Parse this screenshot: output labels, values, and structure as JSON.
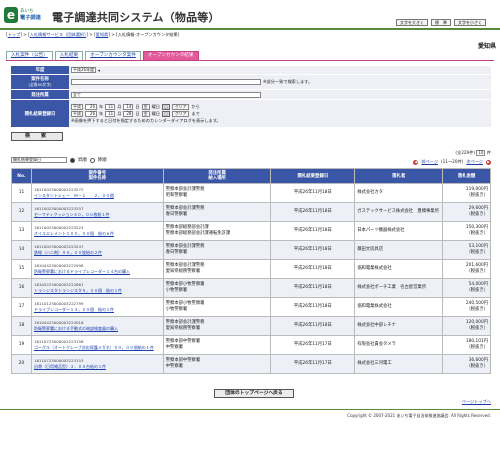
{
  "header": {
    "logo_letter": "e",
    "logo_top": "あいち",
    "logo_bottom": "電子調達",
    "title": "電子調達共同システム（物品等）",
    "buttons": [
      "文字を大きく",
      "標　準",
      "文字を小さく"
    ]
  },
  "breadcrumb": [
    "トップ",
    "入札情報サービス（団体選択）",
    "愛知県",
    "入札情報-オープンカウンタ結果"
  ],
  "region": "愛知県",
  "tabs": [
    "入札案件（公告）",
    "入札結果",
    "オープンカウンタ案件",
    "オープンカウンタ結果"
  ],
  "form": {
    "year_label": "年度",
    "year_value": "平成26年度",
    "name_label": "案件名称",
    "name_sub": "(全角50文字)",
    "name_note": "※部分一致で検索します。",
    "type_label": "発注所属",
    "type_value": "全て",
    "date_label": "開札結果登録日",
    "from_era": "平成",
    "from_y": "26",
    "from_m": "11",
    "from_d": "14",
    "from_w": "金",
    "to_era": "平成",
    "to_y": "26",
    "to_m": "11",
    "to_d": "28",
    "to_w": "金",
    "y": "年",
    "m": "月",
    "d": "日",
    "wd": "曜日",
    "cal": "□",
    "clear": "クリア",
    "from_suffix": "から",
    "to_suffix": "まで",
    "date_note": "※画像を押下すると日付を指定するためのカレンダーダイアログを表示します。",
    "search": "検　索"
  },
  "sort": {
    "value": "開札結果登録日",
    "asc": "昇順",
    "desc": "降順"
  },
  "pager": {
    "total": "(全229件)",
    "per_page": "10",
    "per_suffix": "件",
    "prev": "前ページ",
    "range": "(11～20件)",
    "next": "次ページ"
  },
  "table": {
    "headers": [
      "No.",
      "案件番号\n案件名称",
      "発注所属\n納入場所",
      "開札結果登録日",
      "落札者",
      "落札金額"
    ],
    "rows": [
      {
        "no": "11",
        "num": "16110023000003223272",
        "name": "インスタントシェー　Ｍ－１　　２，００個",
        "dept": "警察本部会計課警務",
        "place": "昭和警察署",
        "date": "平成26年11月18日",
        "bidder": "株式会社カタ",
        "price": "119,000円",
        "tax": "（税抜き）"
      },
      {
        "no": "12",
        "num": "16110023000003223257",
        "name": "セーフティクッション４０，００枚給１件",
        "dept": "警察本部会計課警務",
        "place": "春日警察署",
        "date": "平成26年11月18日",
        "bidder": "ガステックサービス株式会社　豊橋事業所",
        "price": "29,600円",
        "tax": "（税抜き）"
      },
      {
        "no": "13",
        "num": "16110023000003223223",
        "name": "オイルエレメント１００，００個　給の６件",
        "dept": "警察本部総務部会計課",
        "place": "警察本部総務部会計課運転免許課",
        "date": "平成26年11月18日",
        "bidder": "日本パーツ機器株式会社",
        "price": "150,300円",
        "tax": "（税抜き）"
      },
      {
        "no": "14",
        "num": "16110023000003223247",
        "name": "鉄線（ハニ剤）９０，００枚給の２件",
        "dept": "警察本部会計課警務",
        "place": "春日警察署",
        "date": "平成26年11月18日",
        "bidder": "藁田文房具店",
        "price": "53,100円",
        "tax": "（税抜き）"
      },
      {
        "no": "15",
        "num": "16104423000003222998",
        "name": "防衛警察署におけるドライブレコーダー１４台の購入",
        "dept": "警察本部会計課警務",
        "place": "愛知県総務警察署",
        "date": "平成26年11月18日",
        "bidder": "協和電業株式会社",
        "price": "201,600円",
        "tax": "（税抜き）"
      },
      {
        "no": "16",
        "num": "16105223000003222861",
        "name": "トランジスタトランジスタ５，００個　給の１件",
        "dept": "警察本部小牧警察署",
        "place": "小牧警察署",
        "date": "平成26年11月18日",
        "bidder": "株式会社ポーチ工業　名古屋営業所",
        "price": "54,000円",
        "tax": "（税抜き）"
      },
      {
        "no": "17",
        "num": "16110123000003222799",
        "name": "ドライブレコーダー１３，００個　給の１件",
        "dept": "警察本部小牧警察署",
        "place": "小牧警察署",
        "date": "平成26年11月18日",
        "bidder": "協和電業株式会社",
        "price": "240,500円",
        "tax": "（税抜き）"
      },
      {
        "no": "18",
        "num": "16104423000003223016",
        "name": "防衛警察署における手動式の暗部検査器の購入",
        "dept": "警察本部会計課警務",
        "place": "愛知県総務警察署",
        "date": "平成26年11月18日",
        "bidder": "株式会社中部レチナ",
        "price": "120,000円",
        "tax": "（税抜き）"
      },
      {
        "no": "19",
        "num": "16110723000003223158",
        "name": "ゴーグル（オートクレーブ対応保護メガネ）５０，００個給の１件",
        "dept": "警察本部中警察署",
        "place": "中警察署",
        "date": "平成26年11月17日",
        "bidder": "有限会社貴会タメラ",
        "price": "180,101円",
        "tax": "（税抜き）"
      },
      {
        "no": "20",
        "num": "16110723000003223153",
        "name": "出帯（日用雑品型）３，００台給の１件",
        "dept": "警察本部中警察署",
        "place": "中警察署",
        "date": "平成26年11月17日",
        "bidder": "株式会社三河電工",
        "price": "36,600円",
        "tax": "（税抜き）"
      }
    ]
  },
  "back_button": "団体のトップページへ戻る",
  "page_top": "ページトップへ",
  "footer": "Copyright © 2007-2021 あいち電子自治体推進協議会. All Rights Reserved."
}
